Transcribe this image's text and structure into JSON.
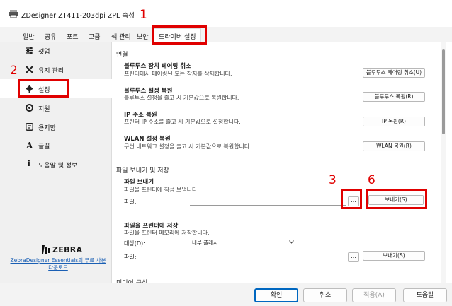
{
  "window": {
    "title": "ZDesigner ZT411-203dpi ZPL 속성"
  },
  "tabs": [
    {
      "label": "일반"
    },
    {
      "label": "공유"
    },
    {
      "label": "포트"
    },
    {
      "label": "고급"
    },
    {
      "label": "색 관리"
    },
    {
      "label": "보안"
    },
    {
      "label": "드라이버 설정"
    }
  ],
  "sidebar": {
    "items": [
      {
        "label": "셋업",
        "icon": "sliders-icon"
      },
      {
        "label": "유지 관리",
        "icon": "tools-icon"
      },
      {
        "label": "설정",
        "icon": "gear-icon"
      },
      {
        "label": "지원",
        "icon": "lifebuoy-icon"
      },
      {
        "label": "용지함",
        "icon": "media-icon"
      },
      {
        "label": "글꼴",
        "icon": "font-icon"
      },
      {
        "label": "도움말 및 정보",
        "icon": "info-icon"
      }
    ],
    "brand": "ZEBRA",
    "link": "ZebraDesigner Essentials의 무료 사본 다운로드"
  },
  "connection": {
    "title": "연결",
    "items": [
      {
        "title": "블루투스 장치 페어링 취소",
        "desc": "프린터에서 페어링된 모든 장치를 삭제합니다.",
        "button": "블루투스 페어링 취소(U)"
      },
      {
        "title": "블루투스 설정 복원",
        "desc": "블루투스 설정을 출고 시 기본값으로 복원합니다.",
        "button": "블루투스 복원(R)"
      },
      {
        "title": "IP 주소 복원",
        "desc": "프린터 IP 주소를 출고 시 기본값으로 설정합니다.",
        "button": "IP 복원(R)"
      },
      {
        "title": "WLAN 설정 복원",
        "desc": "무선 네트워크 설정을 출고 시 기본값으로 복원합니다.",
        "button": "WLAN 복원(R)"
      }
    ]
  },
  "file_transfer": {
    "title": "파일 보내기 및 저장",
    "send": {
      "title": "파일 보내기",
      "desc": "파일을 프린터에 직접 보냅니다.",
      "file_label": "파일:",
      "file_value": "",
      "browse": "...",
      "button": "보내기(S)"
    },
    "store": {
      "title": "파일을 프린터에 저장",
      "desc": "파일을 프린터 메모리에 저장합니다.",
      "target_label": "대상(D):",
      "target_value": "내부 플래시",
      "file_label": "파일:",
      "file_value": "",
      "browse": "...",
      "button": "보내기(S)"
    },
    "next_section_partial": "미디어 구성"
  },
  "dialog_buttons": {
    "ok": "확인",
    "cancel": "취소",
    "apply": "적용(A)",
    "help": "도움말"
  },
  "annotations": [
    "1",
    "2",
    "3",
    "6"
  ],
  "colors": {
    "highlight": "#e00000",
    "link": "#1a5fb4",
    "primary": "#0067c0"
  }
}
